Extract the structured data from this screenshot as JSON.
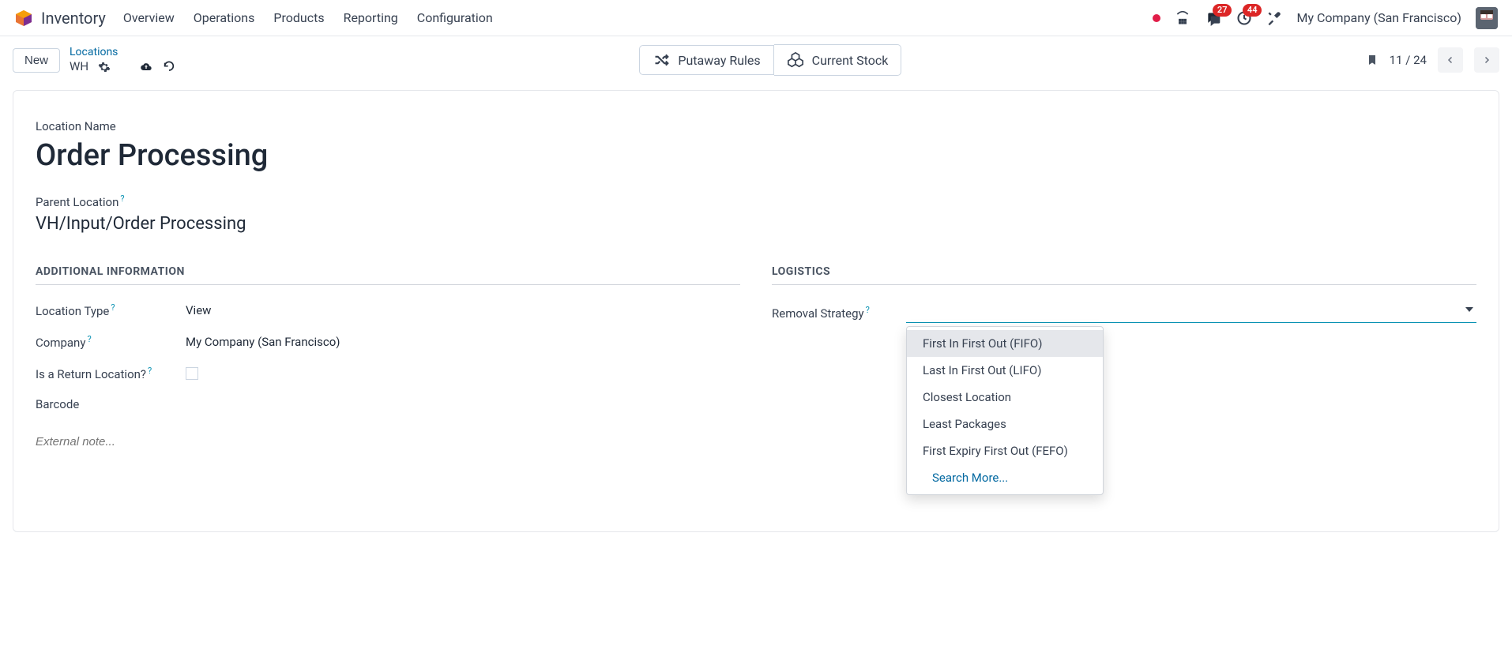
{
  "nav": {
    "app_title": "Inventory",
    "menu": [
      "Overview",
      "Operations",
      "Products",
      "Reporting",
      "Configuration"
    ],
    "badges": {
      "messages": "27",
      "activities": "44"
    },
    "company": "My Company (San Francisco)"
  },
  "control": {
    "new_label": "New",
    "breadcrumb_link": "Locations",
    "breadcrumb_current": "WH",
    "btn_putaway": "Putaway Rules",
    "btn_stock": "Current Stock",
    "pager": "11 / 24"
  },
  "form": {
    "location_name_label": "Location Name",
    "location_name_value": "Order Processing",
    "parent_label": "Parent Location",
    "parent_value": "VH/Input/Order Processing",
    "section_additional": "ADDITIONAL INFORMATION",
    "section_logistics": "LOGISTICS",
    "rows": {
      "location_type_label": "Location Type",
      "location_type_value": "View",
      "company_label": "Company",
      "company_value": "My Company (San Francisco)",
      "return_label": "Is a Return Location?",
      "barcode_label": "Barcode",
      "removal_label": "Removal Strategy"
    },
    "note_placeholder": "External note...",
    "dropdown_options": [
      "First In First Out (FIFO)",
      "Last In First Out (LIFO)",
      "Closest Location",
      "Least Packages",
      "First Expiry First Out (FEFO)"
    ],
    "dropdown_search_more": "Search More..."
  }
}
